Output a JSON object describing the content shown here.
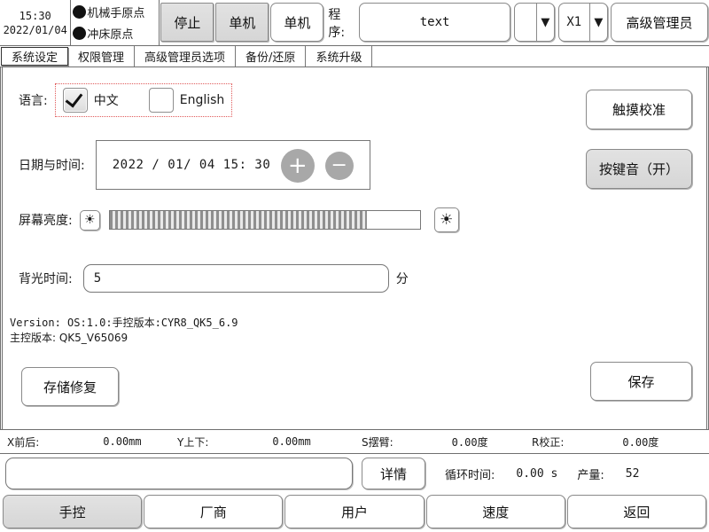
{
  "header": {
    "time": "15:30",
    "date": "2022/01/04",
    "origins": [
      {
        "icon": "status-dot",
        "label": "机械手原点"
      },
      {
        "icon": "status-dot",
        "label": "冲床原点"
      }
    ],
    "buttons": [
      {
        "label": "停止",
        "style": "gray"
      },
      {
        "label": "单机",
        "style": "gray"
      },
      {
        "label": "单机",
        "style": "white"
      }
    ],
    "program_label": "程序:",
    "program_value": "text",
    "selects": [
      {
        "value": "",
        "arrow": "▼"
      },
      {
        "value": "X1",
        "arrow": "▼"
      }
    ],
    "user_button": "高级管理员"
  },
  "tabs": [
    {
      "label": "系统设定",
      "active": true
    },
    {
      "label": "权限管理",
      "active": false
    },
    {
      "label": "高级管理员选项",
      "active": false
    },
    {
      "label": "备份/还原",
      "active": false
    },
    {
      "label": "系统升级",
      "active": false
    }
  ],
  "settings": {
    "language": {
      "label": "语言:",
      "options": [
        {
          "label": "中文",
          "checked": true
        },
        {
          "label": "English",
          "checked": false
        }
      ]
    },
    "datetime": {
      "label": "日期与时间:",
      "value": "2022 / 01/ 04 15: 30",
      "plus": "+",
      "minus": "−"
    },
    "brightness": {
      "label": "屏幕亮度:",
      "icon_small": "☀",
      "icon_large": "☀",
      "fill_percent": 83
    },
    "backlight": {
      "label": "背光时间:",
      "value": "5",
      "unit": "分"
    },
    "version": {
      "line1": "Version: OS:1.0:手控版本:CYR8_QK5_6.9",
      "line2": "主控版本: QK5_V65069"
    },
    "touch_calibration_button": "触摸校准",
    "key_sound_button": "按键音（开）",
    "storage_repair_button": "存储修复",
    "save_button": "保存"
  },
  "status_bar": [
    {
      "name": "X前后:",
      "value": "0.00mm"
    },
    {
      "name": "Y上下:",
      "value": "0.00mm"
    },
    {
      "name": "S摆臂:",
      "value": "0.00度"
    },
    {
      "name": "R校正:",
      "value": "0.00度"
    }
  ],
  "info_row": {
    "message": "",
    "detail_button": "详情",
    "cycle_time_label": "循环时间:",
    "cycle_time_value": "0.00 s",
    "output_label": "产量:",
    "output_value": "52"
  },
  "bottom_nav": [
    {
      "label": "手控",
      "active": true
    },
    {
      "label": "厂商",
      "active": false
    },
    {
      "label": "用户",
      "active": false
    },
    {
      "label": "速度",
      "active": false
    },
    {
      "label": "返回",
      "active": false
    }
  ],
  "colors": {
    "accent_gray": "#d6d6d6",
    "border": "#8a8a8a",
    "focus_red": "#e05a5a"
  }
}
